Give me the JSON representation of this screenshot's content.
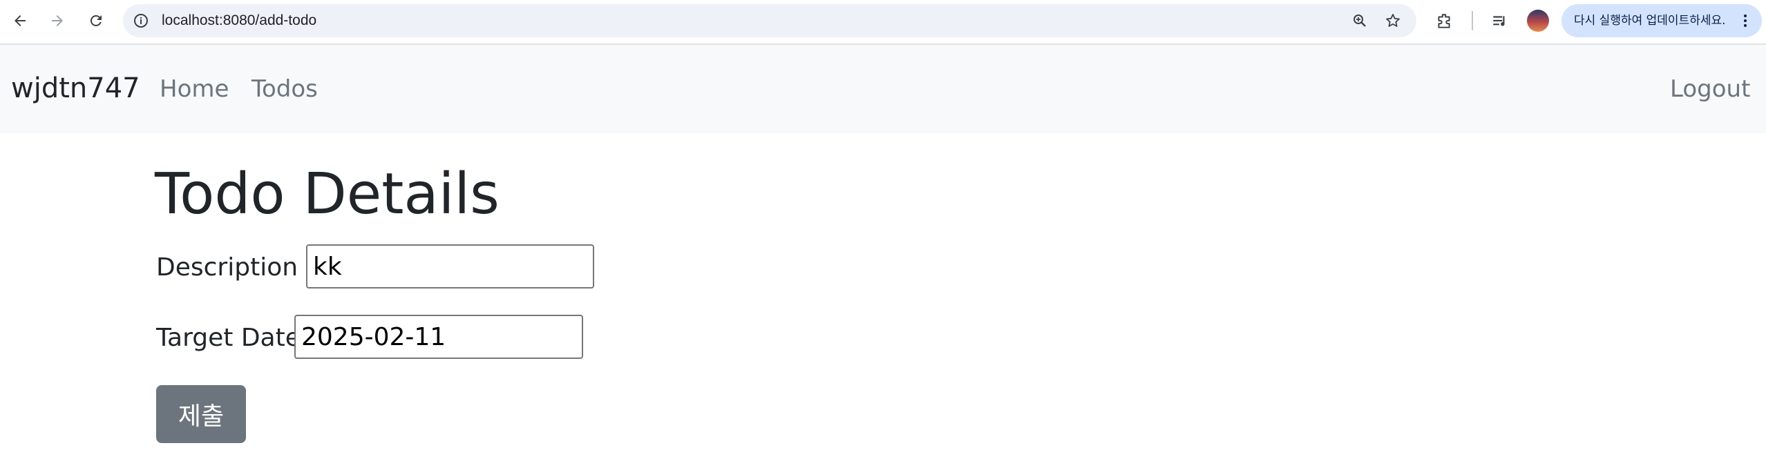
{
  "browser": {
    "url": "localhost:8080/add-todo",
    "update_button_label": "다시 실행하여 업데이트하세요.",
    "icons": [
      "back-arrow-icon",
      "forward-arrow-icon",
      "reload-icon",
      "site-info-icon",
      "zoom-icon",
      "bookmark-star-icon",
      "extensions-icon",
      "media-controls-icon",
      "profile-avatar",
      "more-menu-icon"
    ]
  },
  "navbar": {
    "brand": "wjdtn747",
    "links": [
      {
        "label": "Home"
      },
      {
        "label": "Todos"
      }
    ],
    "logout_label": "Logout",
    "link_color": "#6c757d",
    "background": "#f8f9fa"
  },
  "form": {
    "title": "Todo Details",
    "description_label": "Description :",
    "description_value": "kk",
    "target_date_label": "Target Date",
    "target_date_value": "2025-02-11",
    "submit_label": "제출",
    "submit_color": "#6c757d"
  }
}
